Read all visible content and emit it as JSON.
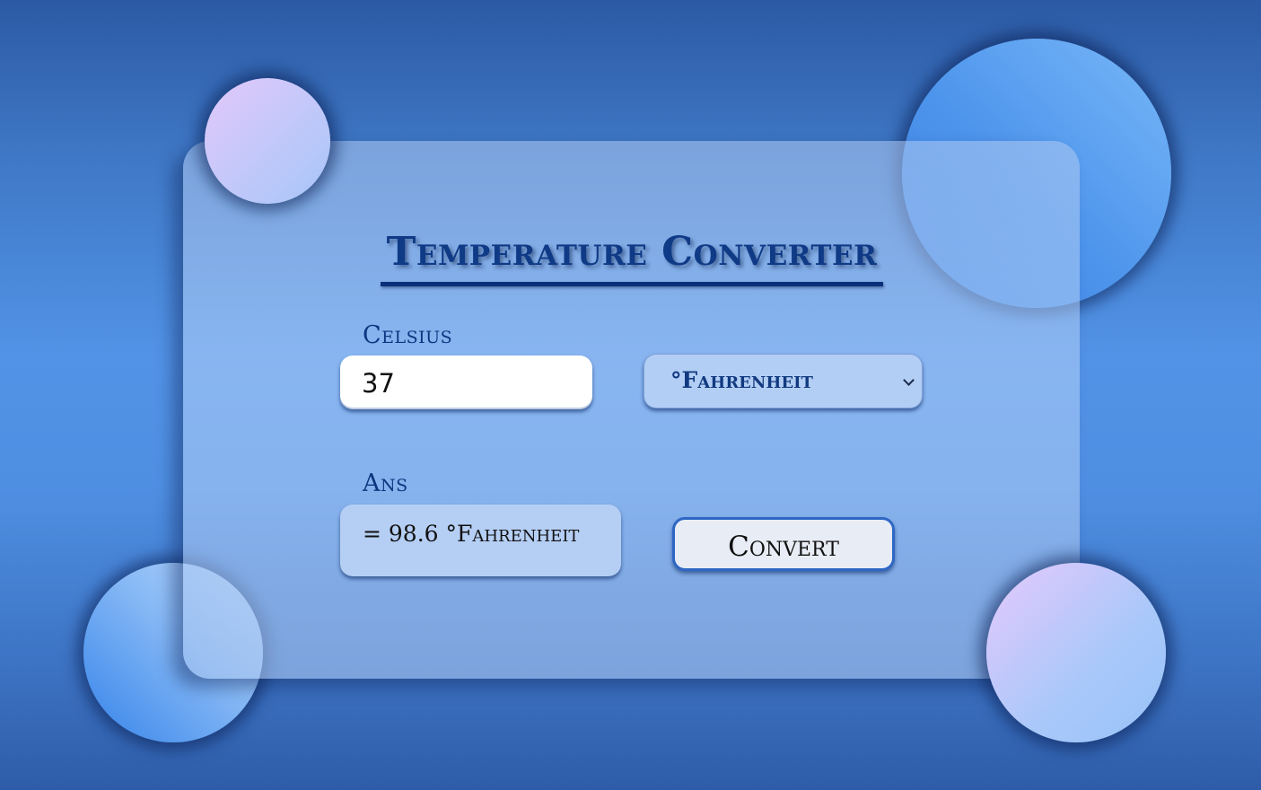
{
  "app": {
    "title": "Temperature Converter"
  },
  "input": {
    "label": "Celsius",
    "value": "37"
  },
  "unit_select": {
    "selected": "°Fahrenheit"
  },
  "result": {
    "label": "Ans",
    "text": "= 98.6 °Fahrenheit"
  },
  "actions": {
    "convert_label": "Convert"
  },
  "colors": {
    "title": "#0f3a86",
    "background": "#4f8fe2",
    "button_border": "#2e67c4"
  }
}
